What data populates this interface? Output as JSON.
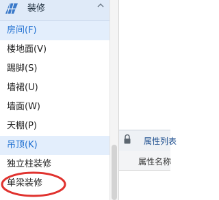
{
  "category": {
    "title": "装修",
    "icon": "walls-icon",
    "collapse_icon": "chevron-up-icon"
  },
  "items": [
    {
      "label": "房间(F)",
      "selected": true
    },
    {
      "label": "楼地面(V)",
      "selected": false
    },
    {
      "label": "踢脚(S)",
      "selected": false
    },
    {
      "label": "墙裙(U)",
      "selected": false
    },
    {
      "label": "墙面(W)",
      "selected": false
    },
    {
      "label": "天棚(P)",
      "selected": false
    },
    {
      "label": "吊顶(K)",
      "selected": true
    },
    {
      "label": "独立柱装修",
      "selected": false
    },
    {
      "label": "单梁装修",
      "selected": false
    }
  ],
  "properties_panel": {
    "tab_label": "属性列表",
    "lock_icon": "lock-icon",
    "column_header": "属性名称"
  },
  "annotation": {
    "color": "#e0322e"
  },
  "colors": {
    "selected_bg": "#e3eefc",
    "selected_text": "#1e6fd1",
    "header_bg": "#dfeaf8"
  }
}
